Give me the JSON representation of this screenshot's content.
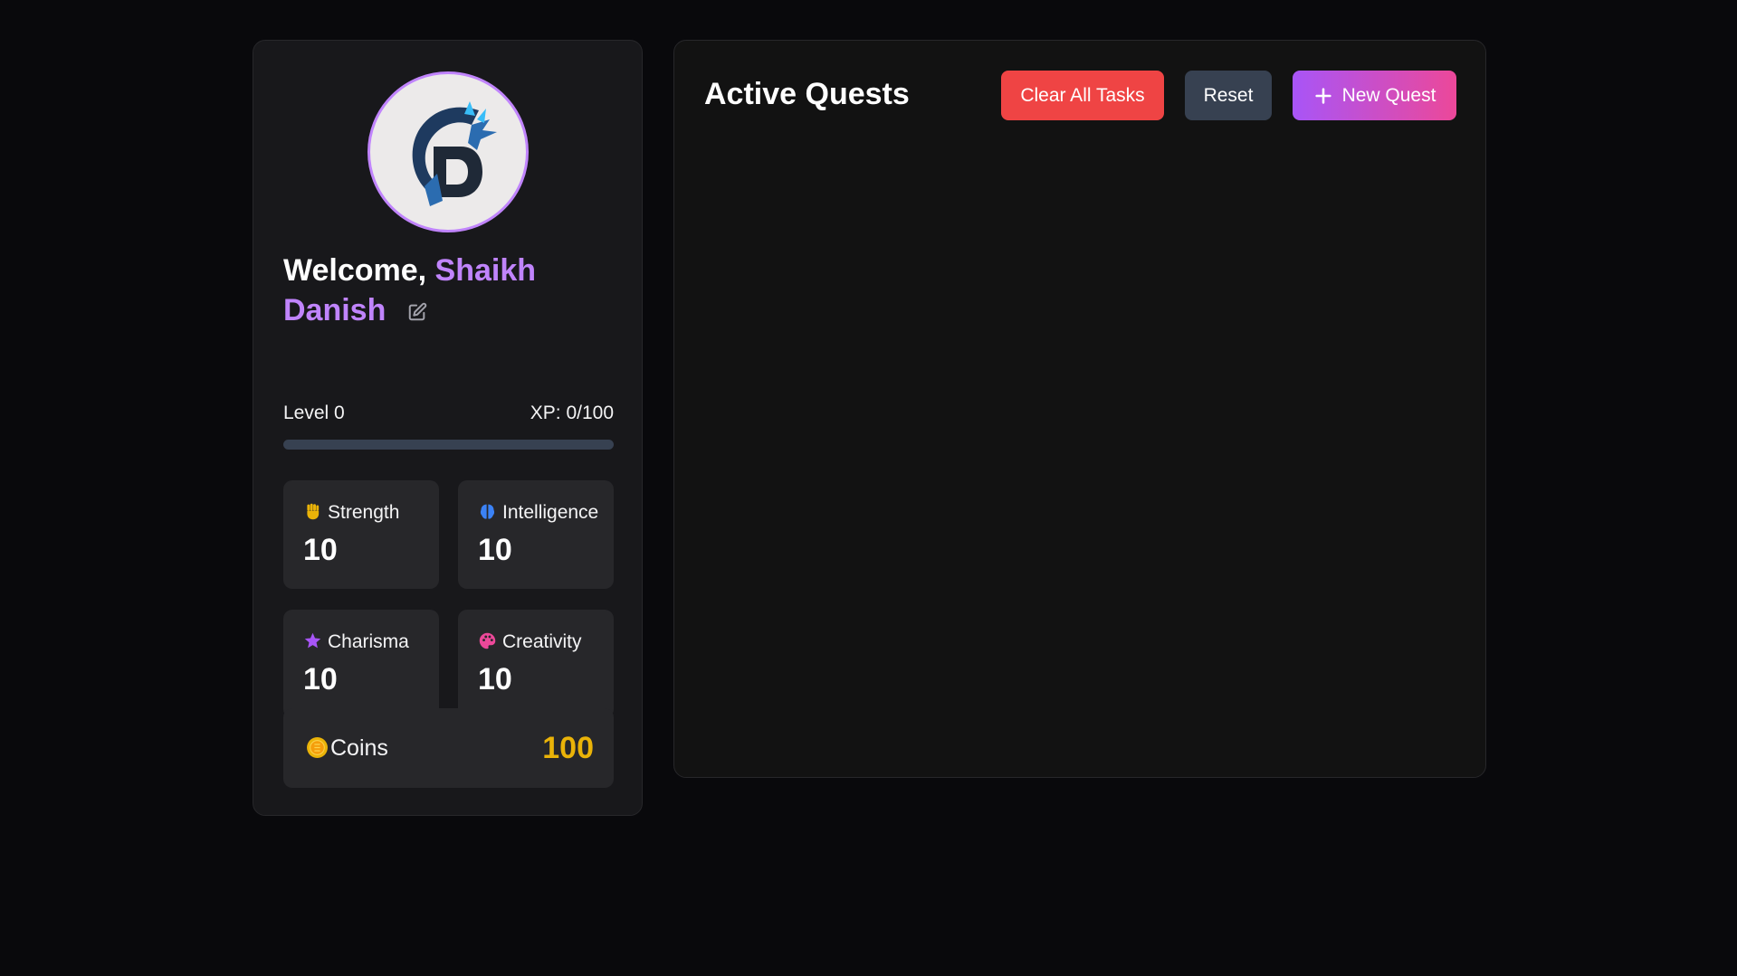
{
  "profile": {
    "welcome_prefix": "Welcome, ",
    "first_name": "Shaikh",
    "last_name": "Danish",
    "level_label": "Level 0",
    "xp_label": "XP: 0/100",
    "xp_progress": 0,
    "avatar_icon": "dragon-logo-icon",
    "edit_icon": "pencil-square-icon"
  },
  "stats": [
    {
      "label": "Strength",
      "value": "10",
      "icon": "fist-icon",
      "color": "#eab308"
    },
    {
      "label": "Intelligence",
      "value": "10",
      "icon": "brain-icon",
      "color": "#3b82f6"
    },
    {
      "label": "Charisma",
      "value": "10",
      "icon": "star-icon",
      "color": "#a855f7"
    },
    {
      "label": "Creativity",
      "value": "10",
      "icon": "palette-icon",
      "color": "#ec4899"
    }
  ],
  "coins": {
    "label": "Coins",
    "value": "100",
    "icon": "coin-icon",
    "color": "#eab308"
  },
  "quests": {
    "title": "Active Quests",
    "clear_label": "Clear All Tasks",
    "reset_label": "Reset",
    "new_label": "New Quest",
    "new_icon": "plus-icon"
  },
  "colors": {
    "accent": "#c084fc",
    "danger": "#ef4444",
    "neutral": "#374151",
    "gradient_start": "#a855f7",
    "gradient_end": "#ec4899"
  }
}
